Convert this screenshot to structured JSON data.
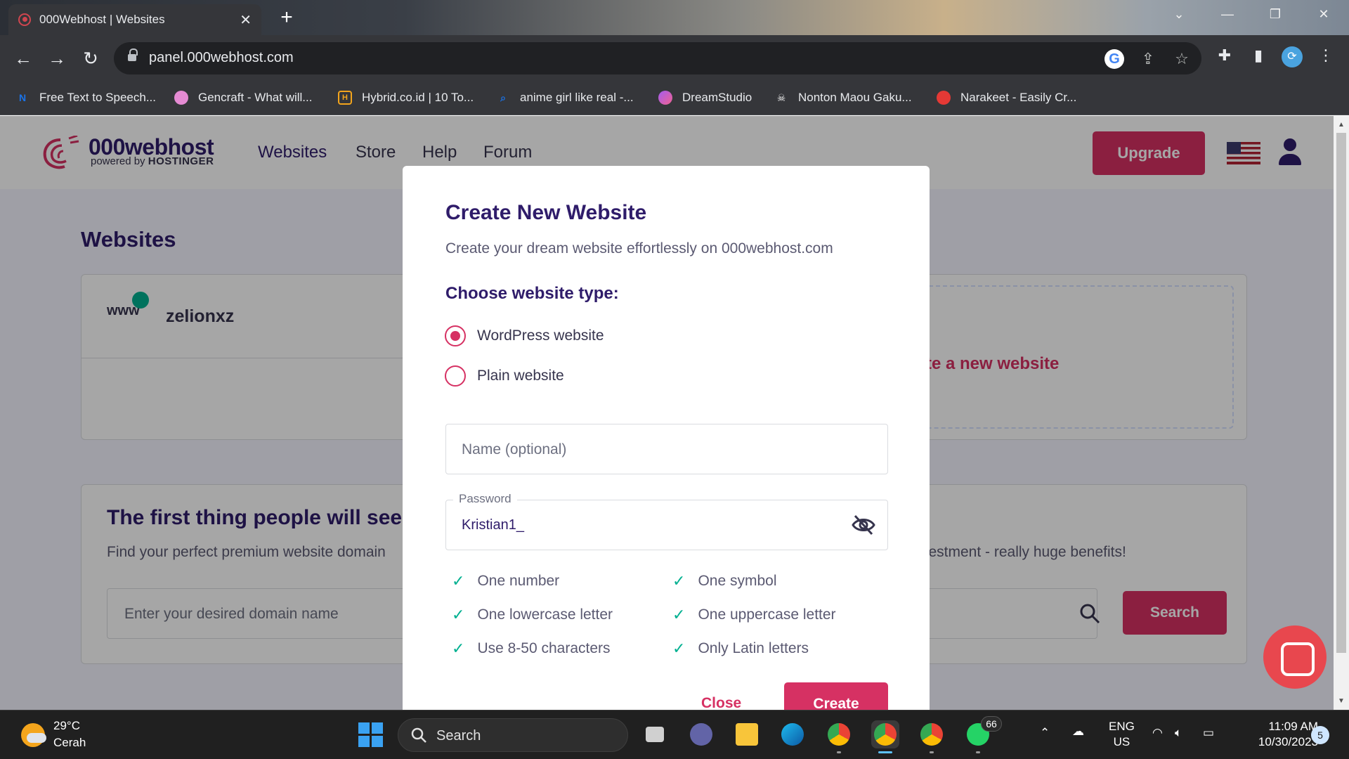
{
  "browser": {
    "tab_title": "000Webhost | Websites",
    "tab_close": "✕",
    "new_tab": "+",
    "url": "panel.000webhost.com",
    "bookmarks": [
      {
        "label": "Free Text to Speech...",
        "icon": "narakeet-n-icon",
        "color": "#1a73e8"
      },
      {
        "label": "Gencraft - What will...",
        "icon": "octopus-icon",
        "color": "#e58bd3"
      },
      {
        "label": "Hybrid.co.id | 10 To...",
        "icon": "hybrid-hex-icon",
        "color": "#f4a51c"
      },
      {
        "label": "anime girl like real -...",
        "icon": "search-icon",
        "color": "#1a73e8"
      },
      {
        "label": "DreamStudio",
        "icon": "dreamstudio-icon",
        "color": "#a35cf0"
      },
      {
        "label": "Nonton Maou Gaku...",
        "icon": "skull-icon",
        "color": "#f1f1f1"
      },
      {
        "label": "Narakeet - Easily Cr...",
        "icon": "parrot-icon",
        "color": "#e53935"
      }
    ]
  },
  "header": {
    "logo_text": "000webhost",
    "logo_sub_prefix": "powered by",
    "logo_sub_brand": "HOSTINGER",
    "nav": [
      "Websites",
      "Store",
      "Help",
      "Forum"
    ],
    "upgrade_label": "Upgrade"
  },
  "main": {
    "title": "Websites",
    "site": {
      "www": "www",
      "name": "zelionxz",
      "status_color": "#00b090"
    },
    "create_tile_text": "te a new website",
    "domain": {
      "title": "The first thing people will see",
      "subtitle": "Find your perfect premium website domain",
      "subtitle_right": "vestment - really huge benefits!",
      "placeholder": "Enter your desired domain name",
      "search_label": "Search"
    }
  },
  "modal": {
    "title": "Create New Website",
    "subtitle": "Create your dream website effortlessly on 000webhost.com",
    "type_label": "Choose website type:",
    "options": [
      {
        "label": "WordPress website",
        "checked": true
      },
      {
        "label": "Plain website",
        "checked": false
      }
    ],
    "name_placeholder": "Name (optional)",
    "password_label": "Password",
    "password_value": "Kristian1_",
    "requirements": [
      "One number",
      "One symbol",
      "One lowercase letter",
      "One uppercase letter",
      "Use 8-50 characters",
      "Only Latin letters"
    ],
    "close_label": "Close",
    "create_label": "Create"
  },
  "taskbar": {
    "weather_temp": "29°C",
    "weather_desc": "Cerah",
    "search_label": "Search",
    "whatsapp_badge": "66",
    "lang_line1": "ENG",
    "lang_line2": "US",
    "time": "11:09 AM",
    "date": "10/30/2023",
    "notifications": "5"
  },
  "colors": {
    "accent": "#d63163",
    "brand_dark": "#2f1c6a",
    "success": "#00b090"
  }
}
